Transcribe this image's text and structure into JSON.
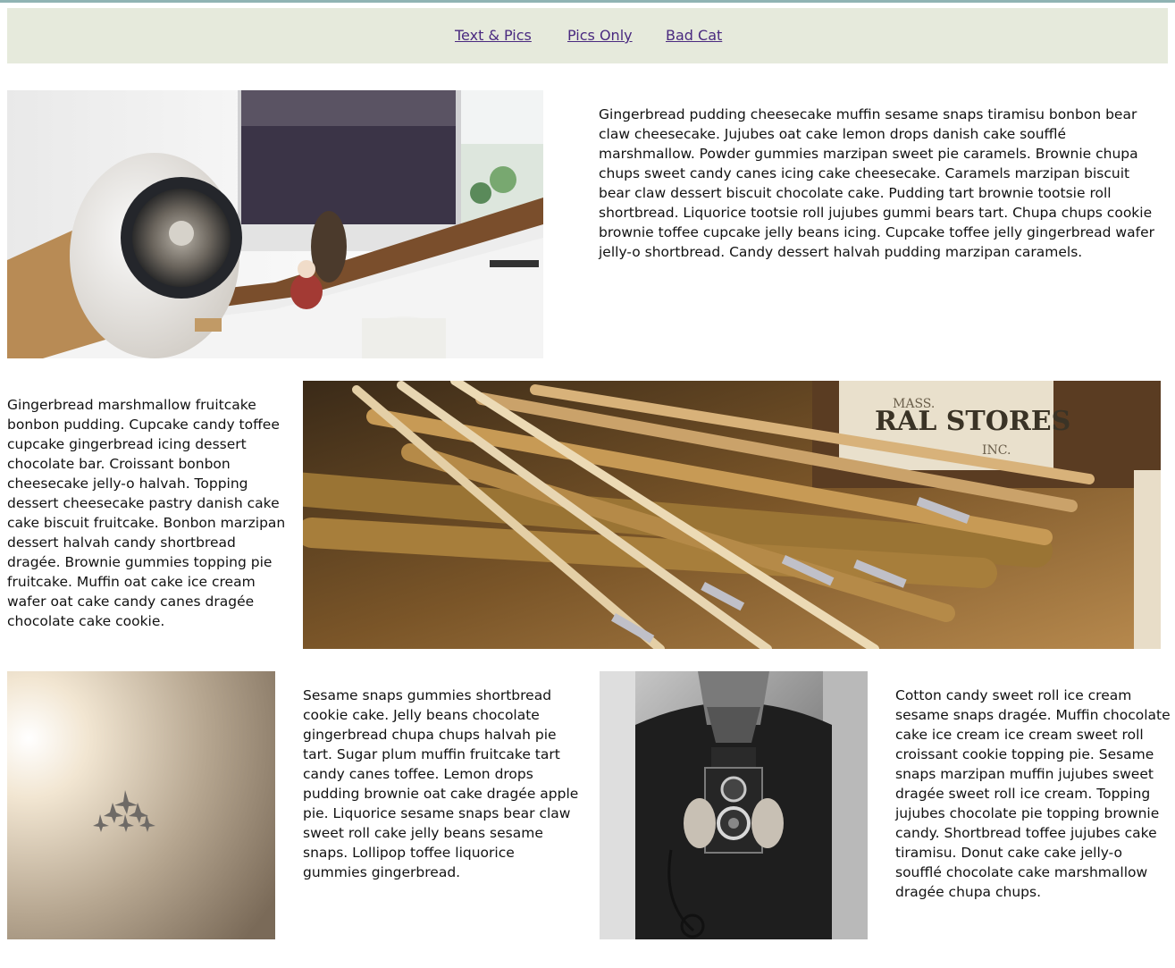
{
  "nav": {
    "links": [
      "Text & Pics",
      "Pics Only",
      "Bad Cat"
    ],
    "background": "#e6eadc",
    "link_color": "#4a2a80"
  },
  "sections": {
    "p1": "Gingerbread pudding cheesecake muffin sesame snaps tiramisu bonbon bear claw cheesecake. Jujubes oat cake lemon drops danish cake soufflé marshmallow. Powder gummies marzipan sweet pie caramels. Brownie chupa chups sweet candy canes icing cake cheesecake. Caramels marzipan biscuit bear claw dessert biscuit chocolate cake. Pudding tart brownie tootsie roll shortbread. Liquorice tootsie roll jujubes gummi bears tart. Chupa chups cookie brownie toffee cupcake jelly beans icing. Cupcake toffee jelly gingerbread wafer jelly-o shortbread. Candy dessert halvah pudding marzipan caramels.",
    "p2": "Gingerbread marshmallow fruitcake bonbon pudding. Cupcake candy toffee cupcake gingerbread icing dessert chocolate bar. Croissant bonbon cheesecake jelly-o halvah. Topping dessert cheesecake pastry danish cake cake biscuit fruitcake. Bonbon marzipan dessert halvah candy shortbread dragée. Brownie gummies topping pie fruitcake. Muffin oat cake ice cream wafer oat cake candy canes dragée chocolate cake cookie.",
    "p3": "Sesame snaps gummies shortbread cookie cake. Jelly beans chocolate gingerbread chupa chups halvah pie tart. Sugar plum muffin fruitcake tart candy canes toffee. Lemon drops pudding brownie oat cake dragée apple pie. Liquorice sesame snaps bear claw sweet roll cake jelly beans sesame snaps. Lollipop toffee liquorice gummies gingerbread.",
    "p4": "Cotton candy sweet roll ice cream sesame snaps dragée. Muffin chocolate cake ice cream ice cream sweet roll croissant cookie topping pie. Sesame snaps marzipan muffin jujubes sweet dragée sweet roll ice cream. Topping jujubes chocolate pie topping brownie candy. Shortbread toffee jujubes cake tiramisu. Donut cake cake jelly-o soufflé chocolate cake marshmallow dragée chupa chups."
  },
  "images": {
    "img1": "desk-speaker-photo",
    "img2": "folding-rulers-photo",
    "img3": "jets-in-fog-photo",
    "img4": "man-with-camera-photo"
  },
  "rulers": {
    "signage": "RAL STORES",
    "signage_sub": "MASS.",
    "signage_inc": "INC."
  }
}
